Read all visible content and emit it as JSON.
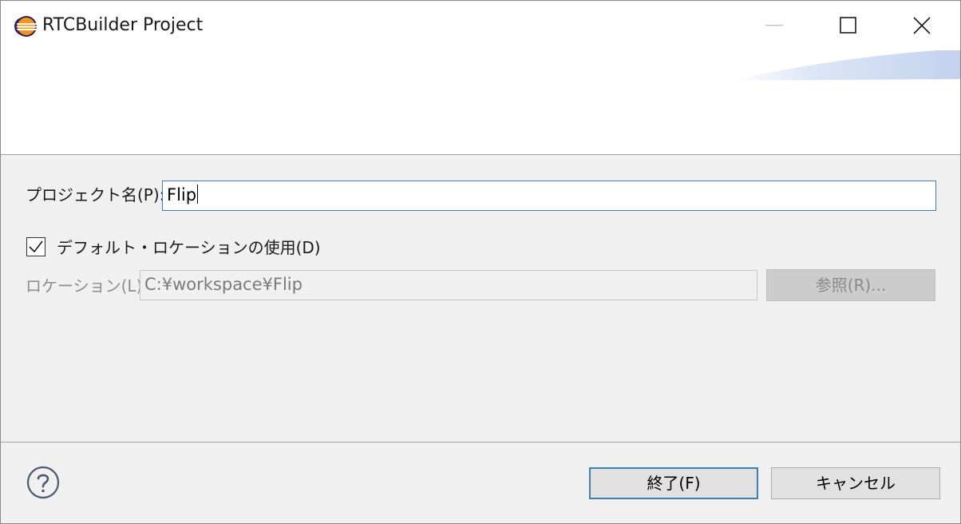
{
  "window": {
    "title": "RTCBuilder Project",
    "app_icon": "eclipse-icon",
    "controls": {
      "minimize_icon": "minimize-icon",
      "maximize_icon": "maximize-icon",
      "close_icon": "close-icon"
    }
  },
  "form": {
    "project_name_label": "プロジェクト名(P):",
    "project_name_value": "Flip",
    "use_default_location_label": "デフォルト・ロケーションの使用(D)",
    "use_default_location_checked": true,
    "location_label": "ロケーション(L):",
    "location_value": "C:¥workspace¥Flip",
    "browse_button_label": "参照(R)..."
  },
  "footer": {
    "help_icon": "help-icon",
    "finish_button_label": "終了(F)",
    "cancel_button_label": "キャンセル"
  },
  "colors": {
    "accent": "#3c7fb1",
    "dialog_background": "#f0f0f0",
    "banner_gradient": "#c9d7f0"
  }
}
